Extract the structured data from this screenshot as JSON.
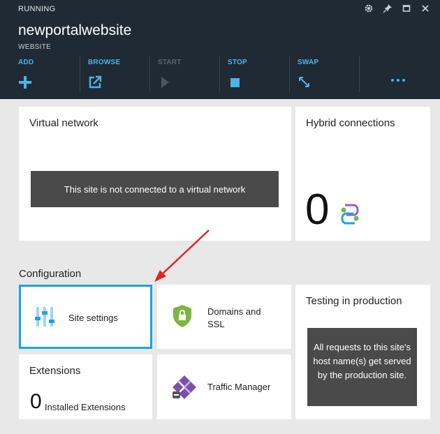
{
  "header": {
    "status": "RUNNING",
    "title": "newportalwebsite",
    "subtitle": "WEBSITE",
    "window_icons": [
      "gear-icon",
      "pin-icon",
      "maximize-icon",
      "close-icon"
    ]
  },
  "commands": [
    {
      "label": "ADD",
      "icon": "plus-icon",
      "enabled": true
    },
    {
      "label": "BROWSE",
      "icon": "browse-icon",
      "enabled": true
    },
    {
      "label": "START",
      "icon": "play-icon",
      "enabled": false
    },
    {
      "label": "STOP",
      "icon": "stop-icon",
      "enabled": true
    },
    {
      "label": "SWAP",
      "icon": "swap-icon",
      "enabled": true
    }
  ],
  "more_icon": "ellipsis-icon",
  "tiles": {
    "virtual_network": {
      "title": "Virtual network",
      "message": "This site is not connected to a virtual network"
    },
    "hybrid_connections": {
      "title": "Hybrid connections",
      "count": "0"
    },
    "configuration_label": "Configuration",
    "site_settings": {
      "label": "Site settings"
    },
    "domains_ssl": {
      "label": "Domains and SSL"
    },
    "testing": {
      "title": "Testing in production",
      "message": "All requests to this site's host name(s) get served by the production site."
    },
    "extensions": {
      "title": "Extensions",
      "count": "0",
      "label": "Installed Extensions"
    },
    "traffic_manager": {
      "label": "Traffic Manager"
    }
  },
  "colors": {
    "header_bg": "#1f2a35",
    "accent": "#4fb3e8",
    "selected_border": "#1ba3e0",
    "annotation_arrow": "#e02424",
    "shield_green": "#7bb742"
  }
}
